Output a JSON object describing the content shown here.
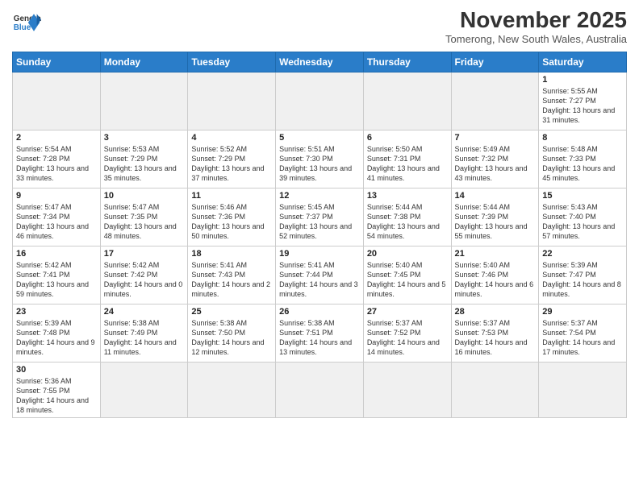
{
  "header": {
    "logo_general": "General",
    "logo_blue": "Blue",
    "month_title": "November 2025",
    "subtitle": "Tomerong, New South Wales, Australia"
  },
  "weekdays": [
    "Sunday",
    "Monday",
    "Tuesday",
    "Wednesday",
    "Thursday",
    "Friday",
    "Saturday"
  ],
  "weeks": [
    [
      {
        "day": "",
        "info": ""
      },
      {
        "day": "",
        "info": ""
      },
      {
        "day": "",
        "info": ""
      },
      {
        "day": "",
        "info": ""
      },
      {
        "day": "",
        "info": ""
      },
      {
        "day": "",
        "info": ""
      },
      {
        "day": "1",
        "info": "Sunrise: 5:55 AM\nSunset: 7:27 PM\nDaylight: 13 hours\nand 31 minutes."
      }
    ],
    [
      {
        "day": "2",
        "info": "Sunrise: 5:54 AM\nSunset: 7:28 PM\nDaylight: 13 hours\nand 33 minutes."
      },
      {
        "day": "3",
        "info": "Sunrise: 5:53 AM\nSunset: 7:29 PM\nDaylight: 13 hours\nand 35 minutes."
      },
      {
        "day": "4",
        "info": "Sunrise: 5:52 AM\nSunset: 7:29 PM\nDaylight: 13 hours\nand 37 minutes."
      },
      {
        "day": "5",
        "info": "Sunrise: 5:51 AM\nSunset: 7:30 PM\nDaylight: 13 hours\nand 39 minutes."
      },
      {
        "day": "6",
        "info": "Sunrise: 5:50 AM\nSunset: 7:31 PM\nDaylight: 13 hours\nand 41 minutes."
      },
      {
        "day": "7",
        "info": "Sunrise: 5:49 AM\nSunset: 7:32 PM\nDaylight: 13 hours\nand 43 minutes."
      },
      {
        "day": "8",
        "info": "Sunrise: 5:48 AM\nSunset: 7:33 PM\nDaylight: 13 hours\nand 45 minutes."
      }
    ],
    [
      {
        "day": "9",
        "info": "Sunrise: 5:47 AM\nSunset: 7:34 PM\nDaylight: 13 hours\nand 46 minutes."
      },
      {
        "day": "10",
        "info": "Sunrise: 5:47 AM\nSunset: 7:35 PM\nDaylight: 13 hours\nand 48 minutes."
      },
      {
        "day": "11",
        "info": "Sunrise: 5:46 AM\nSunset: 7:36 PM\nDaylight: 13 hours\nand 50 minutes."
      },
      {
        "day": "12",
        "info": "Sunrise: 5:45 AM\nSunset: 7:37 PM\nDaylight: 13 hours\nand 52 minutes."
      },
      {
        "day": "13",
        "info": "Sunrise: 5:44 AM\nSunset: 7:38 PM\nDaylight: 13 hours\nand 54 minutes."
      },
      {
        "day": "14",
        "info": "Sunrise: 5:44 AM\nSunset: 7:39 PM\nDaylight: 13 hours\nand 55 minutes."
      },
      {
        "day": "15",
        "info": "Sunrise: 5:43 AM\nSunset: 7:40 PM\nDaylight: 13 hours\nand 57 minutes."
      }
    ],
    [
      {
        "day": "16",
        "info": "Sunrise: 5:42 AM\nSunset: 7:41 PM\nDaylight: 13 hours\nand 59 minutes."
      },
      {
        "day": "17",
        "info": "Sunrise: 5:42 AM\nSunset: 7:42 PM\nDaylight: 14 hours\nand 0 minutes."
      },
      {
        "day": "18",
        "info": "Sunrise: 5:41 AM\nSunset: 7:43 PM\nDaylight: 14 hours\nand 2 minutes."
      },
      {
        "day": "19",
        "info": "Sunrise: 5:41 AM\nSunset: 7:44 PM\nDaylight: 14 hours\nand 3 minutes."
      },
      {
        "day": "20",
        "info": "Sunrise: 5:40 AM\nSunset: 7:45 PM\nDaylight: 14 hours\nand 5 minutes."
      },
      {
        "day": "21",
        "info": "Sunrise: 5:40 AM\nSunset: 7:46 PM\nDaylight: 14 hours\nand 6 minutes."
      },
      {
        "day": "22",
        "info": "Sunrise: 5:39 AM\nSunset: 7:47 PM\nDaylight: 14 hours\nand 8 minutes."
      }
    ],
    [
      {
        "day": "23",
        "info": "Sunrise: 5:39 AM\nSunset: 7:48 PM\nDaylight: 14 hours\nand 9 minutes."
      },
      {
        "day": "24",
        "info": "Sunrise: 5:38 AM\nSunset: 7:49 PM\nDaylight: 14 hours\nand 11 minutes."
      },
      {
        "day": "25",
        "info": "Sunrise: 5:38 AM\nSunset: 7:50 PM\nDaylight: 14 hours\nand 12 minutes."
      },
      {
        "day": "26",
        "info": "Sunrise: 5:38 AM\nSunset: 7:51 PM\nDaylight: 14 hours\nand 13 minutes."
      },
      {
        "day": "27",
        "info": "Sunrise: 5:37 AM\nSunset: 7:52 PM\nDaylight: 14 hours\nand 14 minutes."
      },
      {
        "day": "28",
        "info": "Sunrise: 5:37 AM\nSunset: 7:53 PM\nDaylight: 14 hours\nand 16 minutes."
      },
      {
        "day": "29",
        "info": "Sunrise: 5:37 AM\nSunset: 7:54 PM\nDaylight: 14 hours\nand 17 minutes."
      }
    ],
    [
      {
        "day": "30",
        "info": "Sunrise: 5:36 AM\nSunset: 7:55 PM\nDaylight: 14 hours\nand 18 minutes."
      },
      {
        "day": "",
        "info": ""
      },
      {
        "day": "",
        "info": ""
      },
      {
        "day": "",
        "info": ""
      },
      {
        "day": "",
        "info": ""
      },
      {
        "day": "",
        "info": ""
      },
      {
        "day": "",
        "info": ""
      }
    ]
  ]
}
